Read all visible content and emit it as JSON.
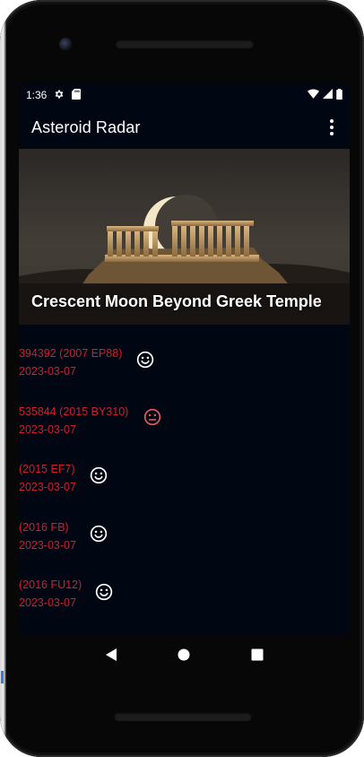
{
  "status_bar": {
    "time": "1:36",
    "icons": [
      "settings-icon",
      "sd-card-icon",
      "wifi-icon",
      "signal-icon",
      "battery-icon"
    ]
  },
  "app_bar": {
    "title": "Asteroid Radar",
    "menu_icon": "overflow-menu-icon"
  },
  "picture_of_day": {
    "title": "Crescent Moon Beyond Greek Temple"
  },
  "asteroids": [
    {
      "name": "394392 (2007 EP88)",
      "date": "2023-03-07",
      "status": "normal",
      "icon": "smile-icon"
    },
    {
      "name": "535844 (2015 BY310)",
      "date": "2023-03-07",
      "status": "hazardous",
      "icon": "neutral-face-icon"
    },
    {
      "name": "(2015 EF7)",
      "date": "2023-03-07",
      "status": "normal",
      "icon": "smile-icon"
    },
    {
      "name": "(2016 FB)",
      "date": "2023-03-07",
      "status": "normal",
      "icon": "smile-icon"
    },
    {
      "name": "(2016 FU12)",
      "date": "2023-03-07",
      "status": "normal",
      "icon": "smile-icon"
    }
  ],
  "nav_bar": {
    "buttons": [
      "back-icon",
      "home-icon",
      "recents-icon"
    ]
  },
  "colors": {
    "screen_background": "#010613",
    "asteroid_text": "#d11f2c",
    "safe_icon": "#ffffff",
    "hazardous_icon": "#e05a5f"
  }
}
